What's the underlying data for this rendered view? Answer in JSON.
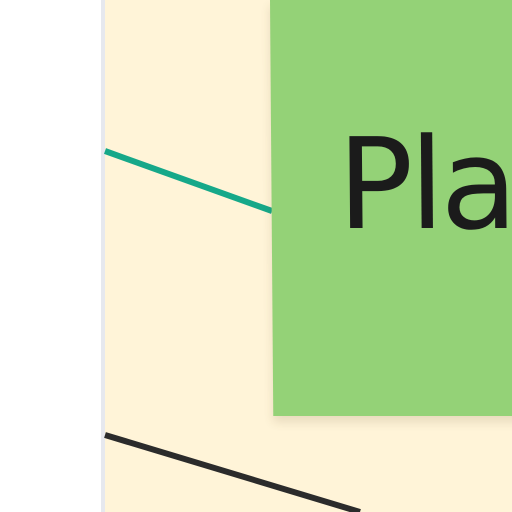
{
  "board": {
    "canvas_color": "#fff4d8",
    "border_color": "#e6e8ee"
  },
  "sticky_note": {
    "text": "Pla",
    "color": "#94d277",
    "text_color": "#1b1b1b"
  },
  "connectors": [
    {
      "name": "teal-connector-line",
      "color": "#16a889"
    },
    {
      "name": "black-connector-line",
      "color": "#2b2b2b"
    }
  ]
}
